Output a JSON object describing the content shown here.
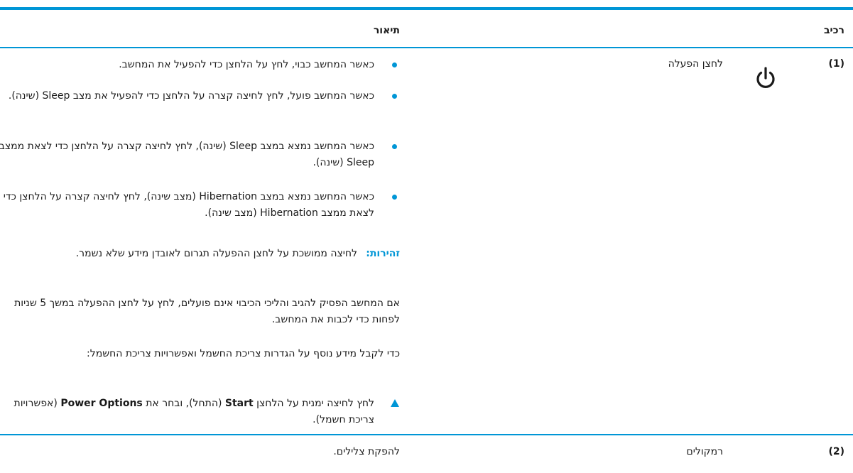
{
  "table": {
    "header": {
      "component": "רכיב",
      "description": "תיאור"
    },
    "rows": [
      {
        "number": "(1)",
        "icon": "power-icon",
        "name": "לחצן הפעלה",
        "bullets": [
          "כאשר המחשב כבוי, לחץ על הלחצן כדי להפעיל את המחשב.",
          "כאשר המחשב פועל, לחץ לחיצה קצרה על הלחצן כדי להפעיל את מצב Sleep (שינה).",
          "כאשר המחשב נמצא במצב Sleep (שינה), לחץ לחיצה קצרה על הלחצן כדי לצאת ממצב Sleep (שינה).",
          "כאשר המחשב נמצא במצב Hibernation (מצב שינה), לחץ לחיצה קצרה על הלחצן כדי לצאת ממצב Hibernation (מצב שינה)."
        ],
        "warning": {
          "label": "זהירות:",
          "text": "לחיצה ממושכת על לחצן ההפעלה תגרום לאובדן מידע שלא נשמר."
        },
        "paragraphs": [
          "אם המחשב הפסיק להגיב והליכי הכיבוי אינם פועלים, לחץ על לחצן ההפעלה במשך 5 שניות לפחות כדי לכבות את המחשב.",
          "כדי לקבל מידע נוסף על הגדרות צריכת החשמל ואפשרויות צריכת החשמל:"
        ],
        "step": {
          "pre": "לחץ לחיצה ימנית על הלחצן ",
          "bold1": "Start",
          "mid": " (התחל), ובחר את ",
          "bold2": "Power Options",
          "post": " (אפשרויות צריכת חשמל)."
        }
      },
      {
        "number": "(2)",
        "name": "רמקולים",
        "description": "להפקת צלילים."
      }
    ]
  },
  "colors": {
    "accent": "#0096d6"
  }
}
